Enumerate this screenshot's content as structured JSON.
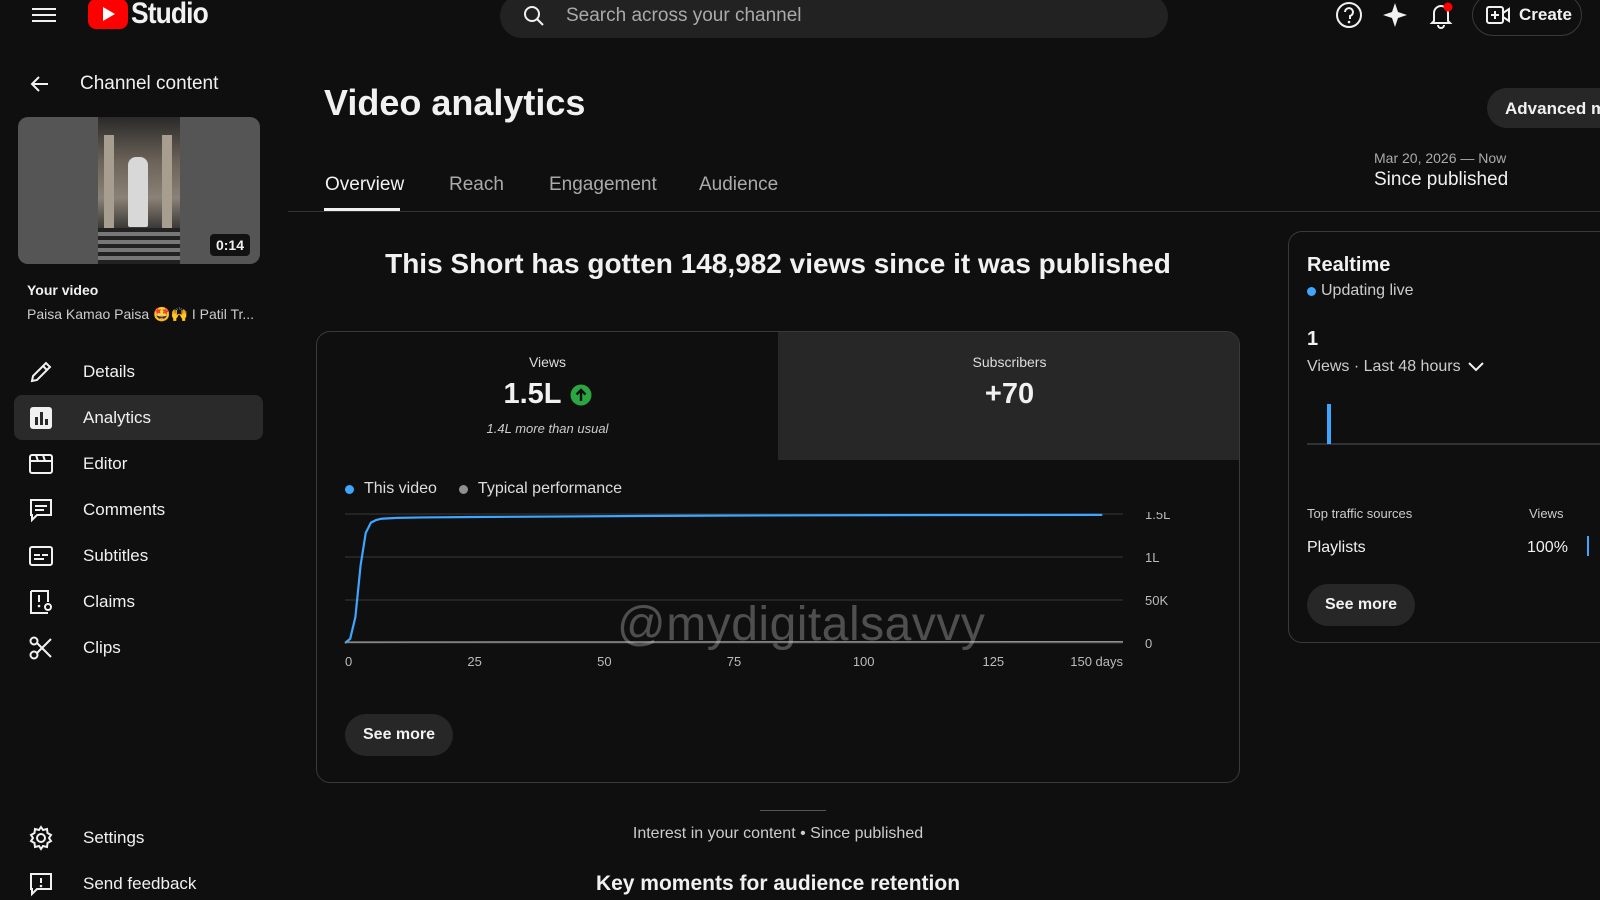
{
  "topbar": {
    "logo_text": "Studio",
    "search_placeholder": "Search across your channel",
    "create_label": "Create"
  },
  "sidebar": {
    "back_label": "Channel content",
    "thumbnail_duration": "0:14",
    "your_video_label": "Your video",
    "video_title": "Paisa Kamao Paisa 🤩🙌 I Patil Tr...",
    "items": [
      {
        "label": "Details",
        "icon": "pencil-icon"
      },
      {
        "label": "Analytics",
        "icon": "analytics-icon"
      },
      {
        "label": "Editor",
        "icon": "editor-icon"
      },
      {
        "label": "Comments",
        "icon": "comments-icon"
      },
      {
        "label": "Subtitles",
        "icon": "subtitles-icon"
      },
      {
        "label": "Claims",
        "icon": "claims-icon"
      },
      {
        "label": "Clips",
        "icon": "scissors-icon"
      }
    ],
    "bottom_items": [
      {
        "label": "Settings",
        "icon": "gear-icon"
      },
      {
        "label": "Send feedback",
        "icon": "feedback-icon"
      }
    ]
  },
  "main": {
    "title": "Video analytics",
    "advanced_button": "Advanced mo",
    "tabs": [
      {
        "label": "Overview",
        "active": true
      },
      {
        "label": "Reach",
        "active": false
      },
      {
        "label": "Engagement",
        "active": false
      },
      {
        "label": "Audience",
        "active": false
      }
    ],
    "date_range": "Mar 20, 2026 — Now",
    "date_label": "Since published",
    "headline": "This Short has gotten 148,982 views since it was published",
    "metrics": {
      "views_label": "Views",
      "views_value": "1.5L",
      "views_note": "1.4L more than usual",
      "subs_label": "Subscribers",
      "subs_value": "+70"
    },
    "legend": {
      "this_video": "This video",
      "typical": "Typical performance"
    },
    "watermark": "@mydigitalsavvy",
    "see_more": "See more",
    "interest": "Interest in your content • Since published",
    "key_moments": "Key moments for audience retention"
  },
  "realtime": {
    "title": "Realtime",
    "live": "Updating live",
    "count": "1",
    "sub": "Views · Last 48 hours",
    "sources_header": "Top traffic sources",
    "views_header": "Views",
    "source_name": "Playlists",
    "source_pct": "100%",
    "see_more": "See more"
  },
  "colors": {
    "background": "#0f0f0f",
    "accent_blue": "#3ea6ff",
    "brand_red": "#ff0000",
    "up_green": "#2ba640"
  },
  "chart_data": {
    "type": "line",
    "x_tick_labels": [
      "0",
      "25",
      "50",
      "75",
      "100",
      "125",
      "150 days"
    ],
    "y_tick_labels": [
      "0",
      "50K",
      "1L",
      "1.5L"
    ],
    "xlim": [
      0,
      150
    ],
    "ylim": [
      0,
      150000
    ],
    "series": [
      {
        "name": "This video",
        "color": "#3ea6ff",
        "x": [
          0,
          1,
          2,
          3,
          4,
          5,
          6,
          7,
          10,
          15,
          25,
          40,
          65,
          90,
          120,
          146
        ],
        "y": [
          0,
          5000,
          30000,
          90000,
          128000,
          140000,
          143000,
          144500,
          145500,
          146000,
          146500,
          147000,
          148000,
          148500,
          148800,
          148982
        ]
      },
      {
        "name": "Typical performance",
        "color": "#909090",
        "x": [
          0,
          150
        ],
        "y": [
          1000,
          1500
        ]
      }
    ]
  }
}
